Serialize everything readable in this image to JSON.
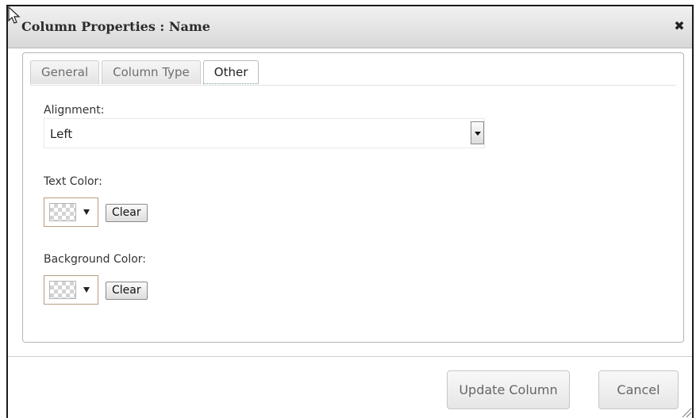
{
  "dialog": {
    "title": "Column Properties : Name",
    "close_icon": "close-icon"
  },
  "tabs": [
    {
      "label": "General",
      "active": false
    },
    {
      "label": "Column Type",
      "active": false
    },
    {
      "label": "Other",
      "active": true
    }
  ],
  "alignment": {
    "label": "Alignment:",
    "value": "Left"
  },
  "text_color": {
    "label": "Text Color:",
    "clear_label": "Clear",
    "swatch": "transparent"
  },
  "background_color": {
    "label": "Background Color:",
    "clear_label": "Clear",
    "swatch": "transparent"
  },
  "footer": {
    "update_label": "Update Column",
    "cancel_label": "Cancel"
  },
  "icons": {
    "mouse_cursor": "mouse-pointer-icon",
    "dropdown": "chevron-down-icon",
    "resize": "resize-grip-icon"
  }
}
